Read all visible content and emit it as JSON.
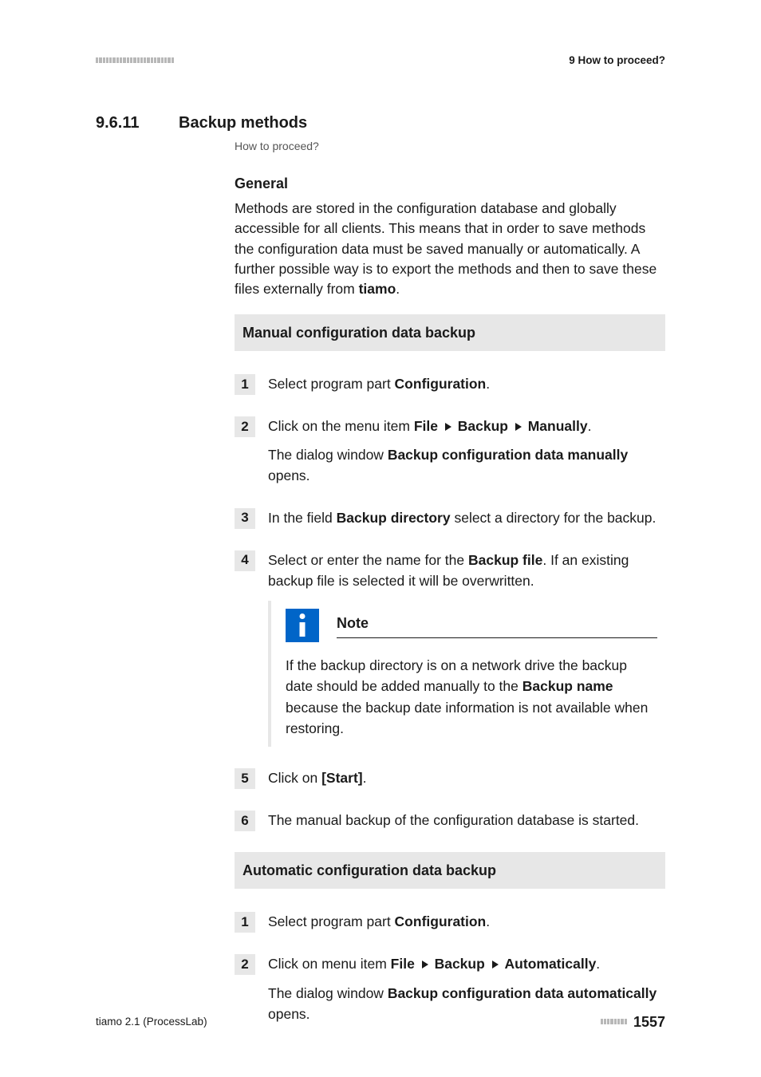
{
  "header": {
    "running_title": "9 How to proceed?"
  },
  "section": {
    "number": "9.6.11",
    "title": "Backup methods",
    "breadcrumb": "How to proceed?"
  },
  "general": {
    "heading": "General",
    "p1_a": "Methods are stored in the configuration database and globally accessible for all clients. This means that in order to save methods the configuration data must be saved manually or automatically. A further possible way is to export the methods and then to save these files externally from ",
    "p1_b_bold": "tiamo",
    "p1_c": "."
  },
  "procA": {
    "title": "Manual configuration data backup",
    "s1_a": "Select program part ",
    "s1_b_bold": "Configuration",
    "s1_c": ".",
    "s2_a": "Click on the menu item ",
    "s2_b_bold": "File",
    "s2_c_bold": "Backup",
    "s2_d_bold": "Manually",
    "s2_e": ".",
    "s2_p2_a": "The dialog window ",
    "s2_p2_b_bold": "Backup configuration data manually",
    "s2_p2_c": " opens.",
    "s3_a": "In the field ",
    "s3_b_bold": "Backup directory",
    "s3_c": " select a directory for the backup.",
    "s4_a": "Select or enter the name for the ",
    "s4_b_bold": "Backup file",
    "s4_c": ". If an existing backup file is selected it will be overwritten.",
    "note_label": "Note",
    "note_a": "If the backup directory is on a network drive the backup date should be added manually to the ",
    "note_b_bold": "Backup name",
    "note_c": " because the backup date information is not available when restoring.",
    "s5_a": "Click on ",
    "s5_b_bold": "[Start]",
    "s5_c": ".",
    "s6": "The manual backup of the configuration database is started."
  },
  "procB": {
    "title": "Automatic configuration data backup",
    "s1_a": "Select program part ",
    "s1_b_bold": "Configuration",
    "s1_c": ".",
    "s2_a": "Click on menu item ",
    "s2_b_bold": "File",
    "s2_c_bold": "Backup",
    "s2_d_bold": "Automatically",
    "s2_e": ".",
    "s2_p2_a": "The dialog window ",
    "s2_p2_b_bold": "Backup configuration data automatically",
    "s2_p2_c": " opens."
  },
  "footer": {
    "left": "tiamo 2.1 (ProcessLab)",
    "page": "1557"
  },
  "nums": {
    "n1": "1",
    "n2": "2",
    "n3": "3",
    "n4": "4",
    "n5": "5",
    "n6": "6"
  }
}
